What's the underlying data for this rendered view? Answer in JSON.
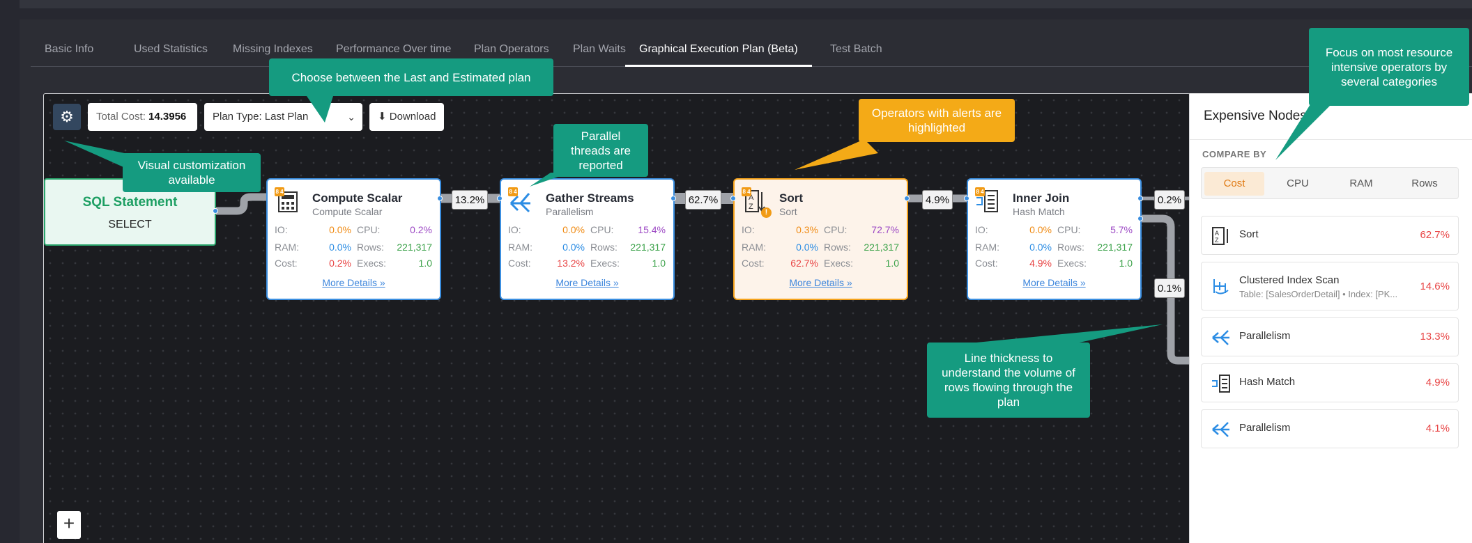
{
  "tabs": [
    "Basic Info",
    "Used Statistics",
    "Missing Indexes",
    "Performance Over time",
    "Plan Operators",
    "Plan Waits",
    "Graphical Execution Plan (Beta)",
    "Test Batch"
  ],
  "active_tab": "Graphical Execution Plan (Beta)",
  "toolbar": {
    "total_cost_label": "Total Cost:",
    "total_cost_value": "14.3956",
    "plan_type": "Plan Type: Last Plan",
    "download": "⬇ Download"
  },
  "sql": {
    "title": "SQL Statement",
    "subtitle": "SELECT"
  },
  "nodes": [
    {
      "title": "Compute Scalar",
      "subtitle": "Compute Scalar",
      "io": "0.0%",
      "cpu": "0.2%",
      "ram": "0.0%",
      "rows": "221,317",
      "cost": "0.2%",
      "execs": "1.0",
      "more": "More Details »"
    },
    {
      "title": "Gather Streams",
      "subtitle": "Parallelism",
      "io": "0.0%",
      "cpu": "15.4%",
      "ram": "0.0%",
      "rows": "221,317",
      "cost": "13.2%",
      "execs": "1.0",
      "more": "More Details »"
    },
    {
      "title": "Sort",
      "subtitle": "Sort",
      "io": "0.3%",
      "cpu": "72.7%",
      "ram": "0.0%",
      "rows": "221,317",
      "cost": "62.7%",
      "execs": "1.0",
      "more": "More Details »"
    },
    {
      "title": "Inner Join",
      "subtitle": "Hash Match",
      "io": "0.0%",
      "cpu": "5.7%",
      "ram": "0.0%",
      "rows": "221,317",
      "cost": "4.9%",
      "execs": "1.0",
      "more": "More Details »"
    }
  ],
  "metric_labels": {
    "io": "IO:",
    "cpu": "CPU:",
    "ram": "RAM:",
    "rows": "Rows:",
    "cost": "Cost:",
    "execs": "Execs:"
  },
  "badge": "8 4",
  "edges": [
    "13.2%",
    "62.7%",
    "4.9%",
    "0.2%",
    "0.1%"
  ],
  "side": {
    "title": "Expensive Nodes",
    "compare_by": "COMPARE BY",
    "segments": [
      "Cost",
      "CPU",
      "RAM",
      "Rows"
    ],
    "active_segment": "Cost",
    "items": [
      {
        "name": "Sort",
        "sub": "",
        "pct": "62.7%",
        "icon": "sort-icon"
      },
      {
        "name": "Clustered Index Scan",
        "sub": "Table: [SalesOrderDetail] • Index: [PK...",
        "pct": "14.6%",
        "icon": "index-scan-icon"
      },
      {
        "name": "Parallelism",
        "sub": "",
        "pct": "13.3%",
        "icon": "parallelism-icon"
      },
      {
        "name": "Hash Match",
        "sub": "",
        "pct": "4.9%",
        "icon": "hash-match-icon"
      },
      {
        "name": "Parallelism",
        "sub": "",
        "pct": "4.1%",
        "icon": "parallelism-icon"
      }
    ]
  },
  "callouts": {
    "plan": "Choose between the Last and Estimated plan",
    "visual": "Visual customization available",
    "parallel": "Parallel threads are reported",
    "alerts": "Operators with alerts are highlighted",
    "focus": "Focus on most resource intensive operators by several categories",
    "line": "Line thickness to understand the volume of rows flowing through the plan"
  },
  "colors": {
    "accent_green": "#159b80",
    "alert_orange": "#f4aa17",
    "node_blue": "#3a8ee0"
  },
  "zoom_in": "+"
}
